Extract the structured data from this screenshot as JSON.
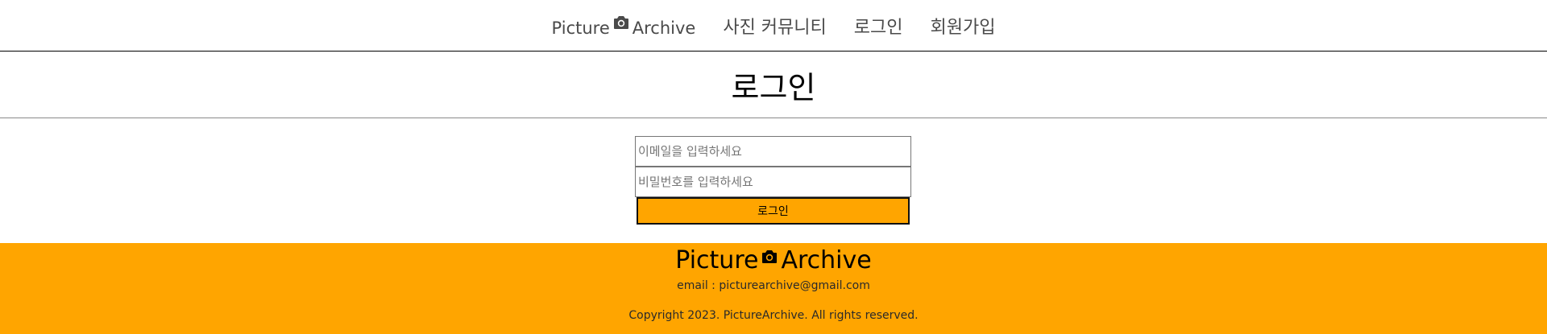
{
  "nav": {
    "logo": {
      "left": "Picture",
      "icon": "camera-icon",
      "right": "Archive"
    },
    "links": [
      "사진 커뮤니티",
      "로그인",
      "회원가입"
    ]
  },
  "page": {
    "title": "로그인"
  },
  "form": {
    "email_placeholder": "이메일을 입력하세요",
    "password_placeholder": "비밀번호를 입력하세요",
    "submit_label": "로그인"
  },
  "footer": {
    "logo": {
      "left": "Picture",
      "icon": "camera-icon",
      "right": "Archive"
    },
    "email": "email : picturearchive@gmail.com",
    "copyright": "Copyright 2023. PictureArchive. All rights reserved."
  },
  "colors": {
    "accent": "#ffa500",
    "nav_text": "#4a4a4a"
  }
}
